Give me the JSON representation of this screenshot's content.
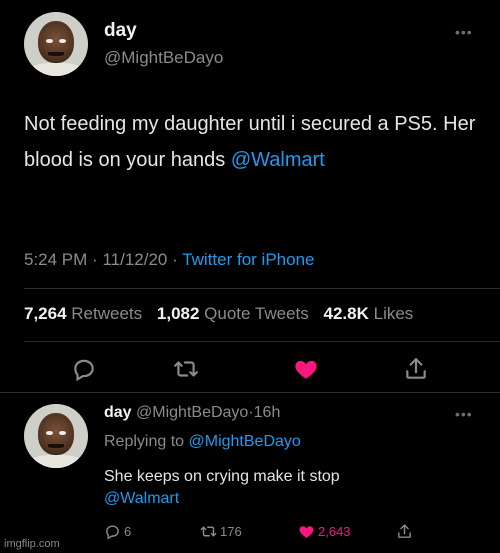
{
  "colors": {
    "background": "#000000",
    "link": "#1d9bf0",
    "like": "#f91880",
    "muted": "#8b8b8b"
  },
  "tweet": {
    "author_name": "day",
    "author_handle": "@MightBeDayo",
    "more_label": "•••",
    "text_before": "Not feeding my daughter until i secured a PS5. Her blood is on your hands ",
    "text_mention": "@Walmart",
    "time": "5:24 PM",
    "date": "11/12/20",
    "separator": "·",
    "source": "Twitter for iPhone",
    "retweets_count": "7,264",
    "retweets_label": "Retweets",
    "quotes_count": "1,082",
    "quotes_label": "Quote Tweets",
    "likes_count": "42.8K",
    "likes_label": "Likes",
    "actions": [
      "reply-icon",
      "retweet-icon",
      "like-icon",
      "share-icon"
    ]
  },
  "reply": {
    "author_name": "day",
    "author_handle": "@MightBeDayo",
    "separator": "·",
    "age": "16h",
    "more_label": "•••",
    "replying_prefix": "Replying to ",
    "replying_mention": "@MightBeDayo",
    "text": "She keeps on crying make it stop",
    "text_mention": "@Walmart",
    "replies": "6",
    "retweets": "176",
    "likes": "2,643"
  },
  "watermark": "imgflip.com"
}
